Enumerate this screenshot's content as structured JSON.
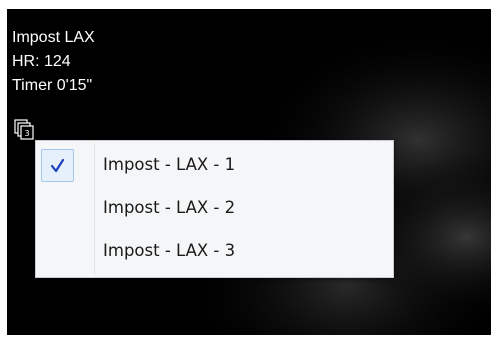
{
  "overlay": {
    "title": "Impost LAX",
    "heart_rate": "HR: 124",
    "timer": "Timer 0'15\""
  },
  "series_icon": {
    "icon": "stacked-series-icon",
    "badge": "3"
  },
  "menu": {
    "items": [
      {
        "label": "Impost - LAX -  1",
        "checked": true
      },
      {
        "label": "Impost - LAX -  2",
        "checked": false
      },
      {
        "label": "Impost - LAX -  3",
        "checked": false
      }
    ],
    "check_icon": "checkmark-icon",
    "check_color": "#1f3fbf"
  }
}
